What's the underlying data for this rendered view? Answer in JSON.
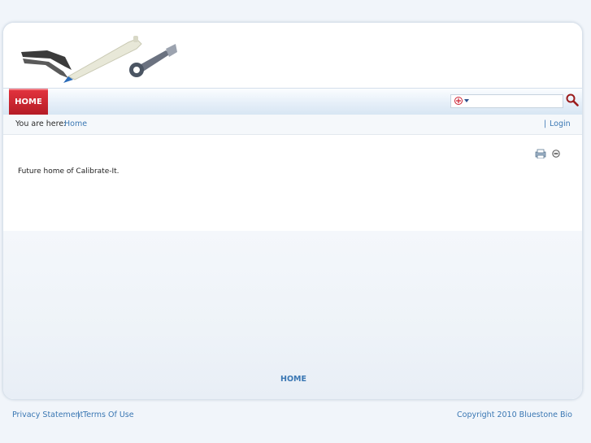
{
  "nav": {
    "home_label": "HOME"
  },
  "search": {
    "placeholder": "",
    "value": ""
  },
  "breadcrumb": {
    "prefix": "You are here:",
    "home_link": "Home",
    "separator": "|",
    "login_label": "Login"
  },
  "content": {
    "text": "Future home of Calibrate-It."
  },
  "footer_nav": {
    "home_label": "HOME"
  },
  "footer": {
    "privacy": "Privacy Statement",
    "separator": "|",
    "terms": "Terms Of Use",
    "copyright": "Copyright 2010 Bluestone Bio"
  },
  "colors": {
    "accent_red": "#c8222c",
    "link_blue": "#3a77b3"
  },
  "icons": {
    "search": "search-icon",
    "print": "print-icon",
    "collapse": "minus-circle-icon",
    "language": "flag-icon"
  }
}
